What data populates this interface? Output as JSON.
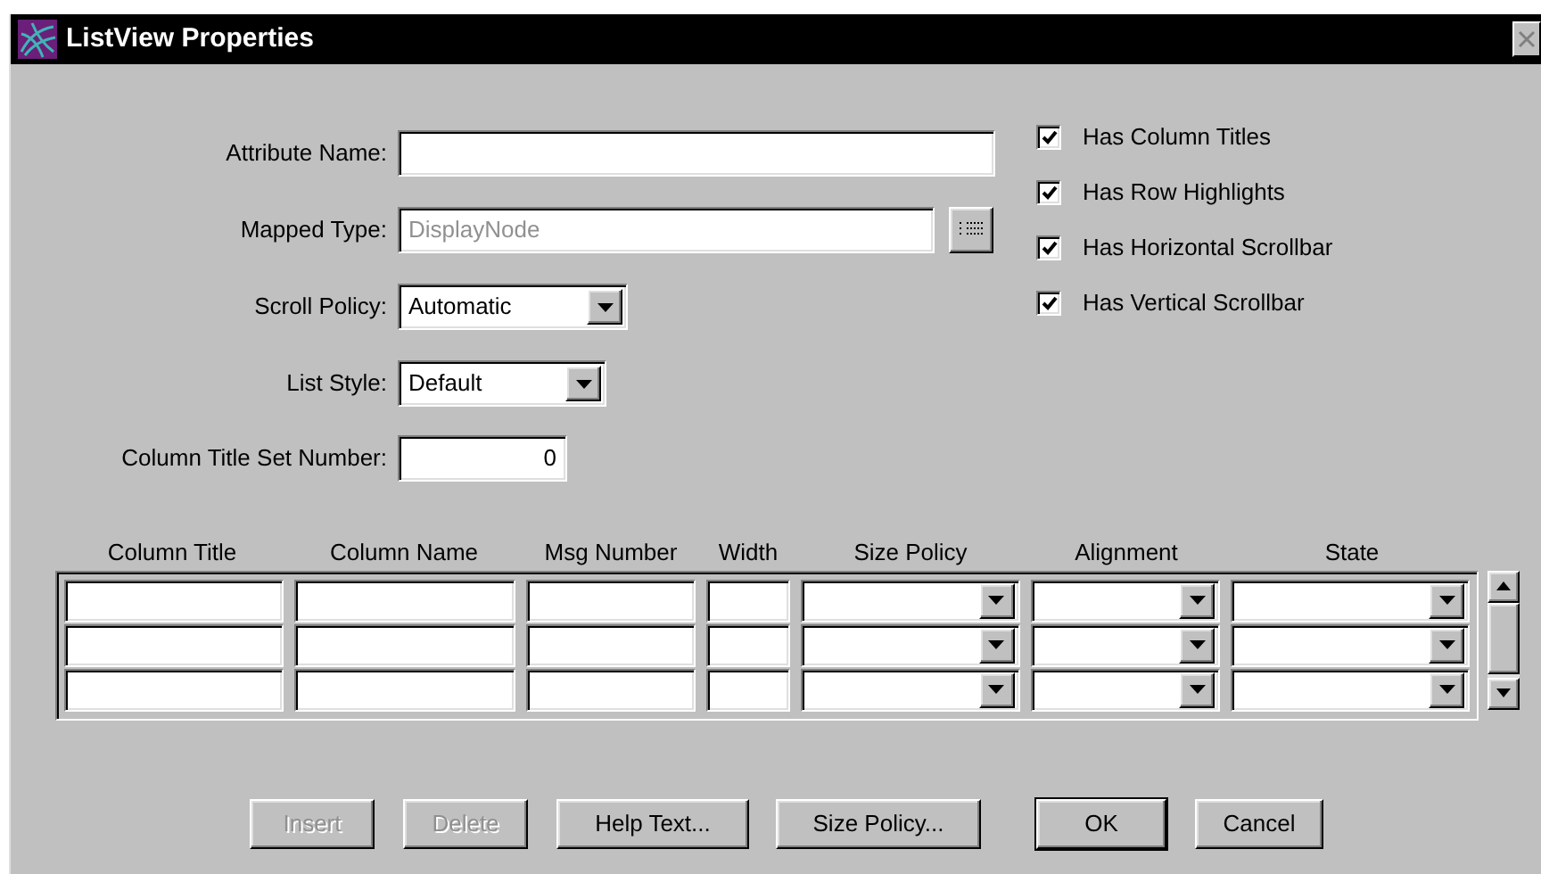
{
  "window": {
    "title": "ListView Properties"
  },
  "form": [
    {
      "label": "Attribute Name:",
      "kind": "text"
    },
    {
      "label": "Mapped Type:",
      "kind": "browse",
      "value": "DisplayNode",
      "disabled": true
    },
    {
      "label": "Scroll Policy:",
      "kind": "combo",
      "value": "Automatic"
    },
    {
      "label": "List Style:",
      "kind": "combo",
      "value": "Default"
    },
    {
      "label": "Column Title Set Number:",
      "kind": "number",
      "value": "0"
    }
  ],
  "options": [
    {
      "label": "Has Column Titles",
      "checked": true
    },
    {
      "label": "Has Row Highlights",
      "checked": true
    },
    {
      "label": "Has Horizontal Scrollbar",
      "checked": true
    },
    {
      "label": "Has Vertical Scrollbar",
      "checked": true
    }
  ],
  "table": {
    "columns": [
      {
        "title": "Column Title",
        "kind": "text"
      },
      {
        "title": "Column Name",
        "kind": "text"
      },
      {
        "title": "Msg Number",
        "kind": "text"
      },
      {
        "title": "Width",
        "kind": "text"
      },
      {
        "title": "Size Policy",
        "kind": "combo"
      },
      {
        "title": "Alignment",
        "kind": "combo"
      },
      {
        "title": "State",
        "kind": "combo"
      }
    ],
    "rows": [
      {},
      {},
      {}
    ]
  },
  "buttons": [
    {
      "label": "Insert",
      "disabled": true,
      "default": false
    },
    {
      "label": "Delete",
      "disabled": true,
      "default": false
    },
    {
      "label": "Help Text...",
      "disabled": false,
      "default": false
    },
    {
      "label": "Size Policy...",
      "disabled": false,
      "default": false
    },
    {
      "label": "OK",
      "disabled": false,
      "default": true
    },
    {
      "label": "Cancel",
      "disabled": false,
      "default": false
    }
  ]
}
